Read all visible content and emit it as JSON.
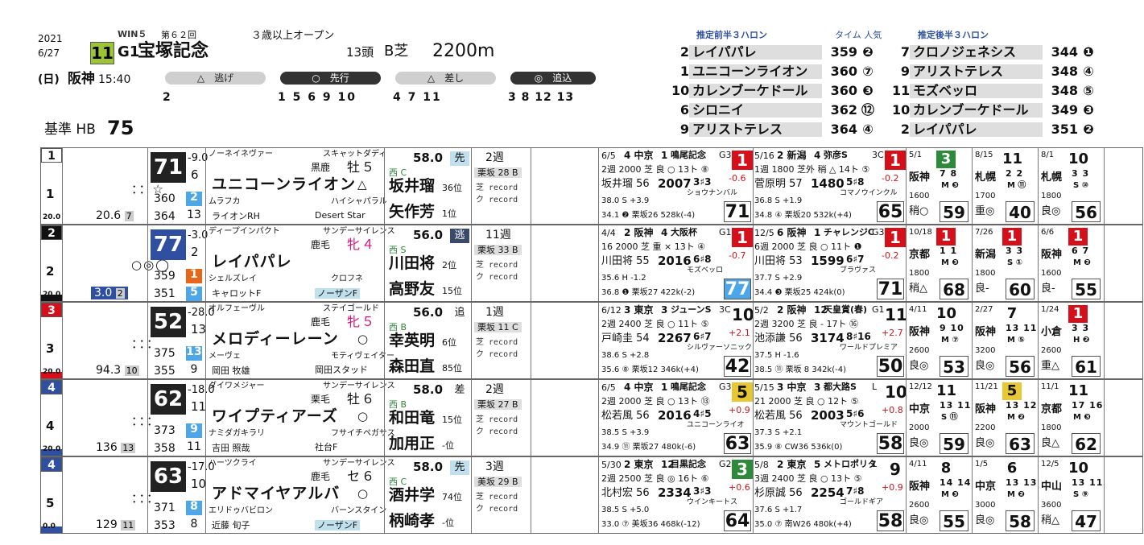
{
  "header": {
    "year": "2021",
    "date": "6/27",
    "win5": "WIN５",
    "kai": "第６２回",
    "race_no": "11",
    "grade": "G1",
    "race_name": "宝塚記念",
    "condition": "３歳以上オープン",
    "heads": "13頭",
    "course": "B芝",
    "distance": "2200m",
    "weekday": "(日)",
    "venue": "阪神",
    "post_time": "15:40",
    "base_label": "基準 HB",
    "base_value": "75",
    "run_styles": [
      {
        "label": "△　逃げ",
        "horses": "2"
      },
      {
        "label": "○　先行",
        "horses": "1 5 6 9 10"
      },
      {
        "label": "△　差し",
        "horses": "4 7 11"
      },
      {
        "label": "◎　追込",
        "horses": "3 8 12 13"
      }
    ]
  },
  "pace": {
    "front_title": "推定前半３ハロン",
    "time_label": "タイム 人気",
    "back_title": "推定後半３ハロン",
    "front": [
      {
        "no": "2",
        "name": "レイパパレ",
        "time": "359",
        "pop": "❷"
      },
      {
        "no": "1",
        "name": "ユニコーンライオン",
        "time": "360",
        "pop": "⑦"
      },
      {
        "no": "10",
        "name": "カレンブーケドール",
        "time": "360",
        "pop": "❸"
      },
      {
        "no": "6",
        "name": "シロニイ",
        "time": "362",
        "pop": "⑫"
      },
      {
        "no": "9",
        "name": "アリストテレス",
        "time": "364",
        "pop": "④"
      }
    ],
    "back": [
      {
        "no": "7",
        "name": "クロノジェネシス",
        "time": "344",
        "pop": "❶"
      },
      {
        "no": "9",
        "name": "アリストテレス",
        "time": "348",
        "pop": "④"
      },
      {
        "no": "11",
        "name": "モズベッロ",
        "time": "348",
        "pop": "⑤"
      },
      {
        "no": "10",
        "name": "カレンブーケドール",
        "time": "349",
        "pop": "❸"
      },
      {
        "no": "2",
        "name": "レイパパレ",
        "time": "351",
        "pop": "❷"
      }
    ]
  },
  "horses": [
    {
      "waku": "1",
      "umaban": "1",
      "marks": "：：☆",
      "odds": "20.6",
      "pop": "7",
      "tansho": "20.0",
      "grade": "71",
      "gdiff": "-9.0",
      "g2": "6",
      "g3": "360",
      "g3b": "2",
      "g4": "364",
      "g4b": "13",
      "sire": "ノーネイネヴァー",
      "dam_sire_top": "スキャットダディ",
      "color": "黒鹿",
      "sex": "牡",
      "age": "５",
      "name": "ユニコーンライオン",
      "mark": "△",
      "dam": "ムラフカ",
      "damsire": "ハイシャパラル",
      "owner": "ライオンRH",
      "breeder": "Desert Star",
      "weight": "58.0",
      "style": "先",
      "stable": "西 C",
      "jockey": "坂井瑠",
      "jrank": "36位",
      "trainer": "矢作芳",
      "trank": "1位",
      "rot": "2週",
      "work": "栗坂 28 B",
      "recent": [
        {
          "date": "6/5",
          "place": "4 中京",
          "no": "1",
          "race": "鳴尾記念",
          "grade": "G3",
          "fin": "1",
          "fc": "r",
          "l2": "2週 2000 芝 良 ○ 13ト ⑧",
          "diff": "-0.6",
          "jk": "坂井瑠 56",
          "time": "2007",
          "c": "3♯3",
          "winner": "ショウナンバル",
          "l4": "38.0 S +3.9",
          "l5": "34.1 ❷ 栗坂26 528k(-4)",
          "spd": "71",
          "spdc": ""
        },
        {
          "date": "5/16",
          "place": "2 新潟",
          "no": "4",
          "race": "弥彦S",
          "grade": "3C",
          "fin": "1",
          "fc": "r",
          "l2": "1週 1800 芝外 稍 △ 14ト ⑤",
          "diff": "-0.2",
          "jk": "菅原明 57",
          "time": "1480",
          "c": "5♯8",
          "winner": "コマノウインクル",
          "l4": "36.8 S +1.9",
          "l5": "34.8 ④ 栗坂20 532k(+4)",
          "spd": "65",
          "spdc": ""
        }
      ],
      "old": [
        {
          "d": "5/1",
          "f": "3",
          "c": "g",
          "v": "阪神",
          "p": "7 8",
          "m": "M ❸",
          "dist": "1600",
          "g": "稍○",
          "s": "59"
        },
        {
          "d": "8/15",
          "f": "11",
          "c": "",
          "v": "札幌",
          "p": "2 2",
          "m": "M ⑪",
          "dist": "1700",
          "g": "重◎",
          "s": "40"
        },
        {
          "d": "8/1",
          "f": "10",
          "c": "",
          "v": "札幌",
          "p": "3 3",
          "m": "S ⑩",
          "dist": "1800",
          "g": "良◎",
          "s": "56"
        }
      ]
    },
    {
      "waku": "2",
      "umaban": "2",
      "marks": "○◎◯",
      "odds": "3.0",
      "pop": "2",
      "tansho": "20.0",
      "grade": "77",
      "gdiff": "-3.0",
      "g2": "2",
      "g3": "359",
      "g3b": "1",
      "g4": "351",
      "g4b": "5",
      "sire": "ディープインパクト",
      "dam_sire_top": "サンデーサイレンス",
      "color": "鹿毛",
      "sex": "牝",
      "age": "４",
      "name": "レイパパレ",
      "mark": "",
      "dam": "シェルズレイ",
      "damsire": "クロフネ",
      "owner": "キャロットF",
      "breeder": "ノーザンF",
      "weight": "56.0",
      "style": "逃",
      "stable": "西 S",
      "jockey": "川田将",
      "jrank": "2位",
      "trainer": "高野友",
      "trank": "15位",
      "rot": "11週",
      "work": "栗坂 33 B",
      "recent": [
        {
          "date": "4/4",
          "place": "2 阪神",
          "no": "4",
          "race": "大阪杯",
          "grade": "G1",
          "fin": "1",
          "fc": "r",
          "l2": "16 2000 芝 重 × 13ト ④",
          "diff": "-0.7",
          "jk": "川田将 55",
          "time": "2016",
          "c": "6♯8",
          "winner": "モズベッロ",
          "l4": "35.6 H -1.2",
          "l5": "36.8 ❶ 栗坂27 422k(-2)",
          "spd": "77",
          "spdc": "bl"
        },
        {
          "date": "12/5",
          "place": "6 阪神",
          "no": "1",
          "race": "チャレンジC",
          "grade": "G3",
          "fin": "1",
          "fc": "r",
          "l2": "6週 2000 芝 良 ○ 11ト ❶",
          "diff": "-0.2",
          "jk": "川田将 53",
          "time": "1599",
          "c": "6♯7",
          "winner": "ブラヴァス",
          "l4": "37.7 S +2.9",
          "l5": "34.4 ❸ 栗坂25 424k(0)",
          "spd": "71",
          "spdc": ""
        }
      ],
      "old": [
        {
          "d": "10/18",
          "f": "1",
          "c": "r",
          "v": "京都",
          "p": "1 1",
          "m": "M ❸",
          "dist": "1800",
          "g": "稍△",
          "s": "68"
        },
        {
          "d": "7/26",
          "f": "1",
          "c": "r",
          "v": "新潟",
          "p": "3 3",
          "m": "S ①",
          "dist": "1800",
          "g": "良-",
          "s": "60"
        },
        {
          "d": "6/6",
          "f": "1",
          "c": "r",
          "v": "阪神",
          "p": "6 7",
          "m": "M ❷",
          "dist": "1600",
          "g": "良-",
          "s": "55"
        }
      ]
    },
    {
      "waku": "3",
      "umaban": "3",
      "marks": "：：：",
      "odds": "94.3",
      "pop": "10",
      "tansho": "20.0",
      "grade": "52",
      "gdiff": "-28.0",
      "g2": "13",
      "g3": "375",
      "g3b": "13",
      "g4": "355",
      "g4b": "9",
      "sire": "オルフェーヴル",
      "dam_sire_top": "ステイゴールド",
      "color": "鹿毛",
      "sex": "牝",
      "age": "５",
      "name": "メロディーレーン",
      "mark": "○",
      "dam": "メーヴェ",
      "damsire": "モティヴェイター",
      "owner": "岡田 牧雄",
      "breeder": "岡田スタッド",
      "weight": "56.0",
      "style": "追",
      "stable": "西 B",
      "jockey": "幸英明",
      "jrank": "6位",
      "trainer": "森田直",
      "trank": "85位",
      "rot": "1週",
      "work": "栗坂 11 C",
      "recent": [
        {
          "date": "6/12",
          "place": "3 東京",
          "no": "3",
          "race": "ジューンS",
          "grade": "3C",
          "fin": "10",
          "fc": "",
          "l2": "2週 2400 芝 良 ○ 11ト ⑤",
          "diff": "+2.1",
          "jk": "戸崎圭 54",
          "time": "2267",
          "c": "6♯7",
          "winner": "シルヴァーソニック",
          "l4": "38.6 S +2.8",
          "l5": "35.6 ⑧ 栗坂12 346k(+4)",
          "spd": "42",
          "spdc": ""
        },
        {
          "date": "5/2",
          "place": "2 阪神",
          "no": "12",
          "race": "天皇賞(春)",
          "grade": "G1",
          "fin": "11",
          "fc": "",
          "l2": "2週 3200 芝 良 - 17ト ⑯",
          "diff": "+2.7",
          "jk": "池添謙 56",
          "time": "3174",
          "c": "8♯16",
          "winner": "ワールドプレミア",
          "l4": "37.5 H -1.6",
          "l5": "38.5 ⑪ 栗坂 8 342k(-4)",
          "spd": "50",
          "spdc": ""
        }
      ],
      "old": [
        {
          "d": "4/11",
          "f": "10",
          "c": "",
          "v": "阪神",
          "p": "9 10",
          "m": "M ⑦",
          "dist": "2600",
          "g": "良◎",
          "s": "53"
        },
        {
          "d": "2/27",
          "f": "7",
          "c": "",
          "v": "阪神",
          "p": "13 11",
          "m": "M ⑤",
          "dist": "3200",
          "g": "良◎",
          "s": "56"
        },
        {
          "d": "1/24",
          "f": "1",
          "c": "r",
          "v": "小倉",
          "p": "3 3",
          "m": "H ❷",
          "dist": "2600",
          "g": "重△",
          "s": "61"
        }
      ]
    },
    {
      "waku": "4",
      "umaban": "4",
      "marks": "：：：",
      "odds": "136",
      "pop": "13",
      "tansho": "20.0",
      "grade": "62",
      "gdiff": "-18.0",
      "g2": "11",
      "g3": "373",
      "g3b": "9",
      "g4": "358",
      "g4b": "11",
      "sire": "ダイワメジャー",
      "dam_sire_top": "サンデーサイレンス",
      "color": "栗毛",
      "sex": "牡",
      "age": "６",
      "name": "ワイプティアーズ",
      "mark": "○",
      "dam": "ナミダガキラリ",
      "damsire": "フサイチペガサス",
      "owner": "吉田 照哉",
      "breeder": "社台F",
      "weight": "58.0",
      "style": "差",
      "stable": "西 B",
      "jockey": "和田竜",
      "jrank": "15位",
      "trainer": "加用正",
      "trank": "-位",
      "rot": "2週",
      "work": "栗坂 27 B",
      "recent": [
        {
          "date": "6/5",
          "place": "4 中京",
          "no": "1",
          "race": "鳴尾記念",
          "grade": "G3",
          "fin": "5",
          "fc": "y",
          "l2": "2週 2000 芝 良 ○ 13ト ⑬",
          "diff": "+0.9",
          "jk": "松若風 56",
          "time": "2016",
          "c": "4♯5",
          "winner": "ユニコーンライオ",
          "l4": "38.5 S +3.9",
          "l5": "34.9 ⑪ 栗坂27 480k(-6)",
          "spd": "63",
          "spdc": ""
        },
        {
          "date": "5/15",
          "place": "3 中京",
          "no": "3",
          "race": "都大路S",
          "grade": "L",
          "fin": "10",
          "fc": "",
          "l2": "21 2000 芝 良 ○ 12ト ⑤",
          "diff": "+0.8",
          "jk": "松若風 56",
          "time": "2003",
          "c": "5♯6",
          "winner": "マウントゴールド",
          "l4": "37.3 S +2.1",
          "l5": "35.9 ⑧ CW36 536k(0)",
          "spd": "58",
          "spdc": ""
        }
      ],
      "old": [
        {
          "d": "12/12",
          "f": "11",
          "c": "",
          "v": "中京",
          "p": "13 11",
          "m": "S ⑪",
          "dist": "2000",
          "g": "良◎",
          "s": "59"
        },
        {
          "d": "11/21",
          "f": "5",
          "c": "y",
          "v": "阪神",
          "p": "13 12",
          "m": "M ❷",
          "dist": "2200",
          "g": "良◎",
          "s": "63"
        },
        {
          "d": "11/1",
          "f": "11",
          "c": "",
          "v": "京都",
          "p": "17 16",
          "m": "M ❸",
          "dist": "1800",
          "g": "良△",
          "s": "62"
        }
      ]
    },
    {
      "waku": "4",
      "umaban": "5",
      "marks": "：：：",
      "odds": "129",
      "pop": "11",
      "tansho": "0.0",
      "grade": "63",
      "gdiff": "-17.0",
      "g2": "10",
      "g3": "371",
      "g3b": "8",
      "g4": "353",
      "g4b": "8",
      "sire": "ハーツクライ",
      "dam_sire_top": "サンデーサイレンス",
      "color": "鹿毛",
      "sex": "セ",
      "age": "６",
      "name": "アドマイヤアルバ",
      "mark": "○",
      "dam": "エリドゥバビロン",
      "damsire": "バーンスタイン",
      "owner": "近藤 旬子",
      "breeder": "ノーザンF",
      "weight": "58.0",
      "style": "先",
      "stable": "西 C",
      "jockey": "酒井学",
      "jrank": "74位",
      "trainer": "柄崎孝",
      "trank": "-位",
      "rot": "3週",
      "work": "美坂 29 B",
      "recent": [
        {
          "date": "5/30",
          "place": "2 東京",
          "no": "12",
          "race": "目黒記念",
          "grade": "G2",
          "fin": "3",
          "fc": "g",
          "l2": "2週 2500 芝 良 ◎ 16ト ⑥",
          "diff": "+0.6",
          "jk": "北村宏 56",
          "time": "2334",
          "c": "3♯3",
          "winner": "ウインキートス",
          "l4": "38.5 S +5.0",
          "l5": "33.0 ⑦ 美坂36 468k(-12)",
          "spd": "64",
          "spdc": ""
        },
        {
          "date": "5/8",
          "place": "2 東京",
          "no": "5",
          "race": "メトロポリタ",
          "grade": "L",
          "fin": "9",
          "fc": "",
          "l2": "3週 2400 芝 良 ○ 13ト ⑤",
          "diff": "+0.9",
          "jk": "杉原誠 56",
          "time": "2254",
          "c": "7♯8",
          "winner": "ゴールドギア",
          "l4": "37.6 S +1.7",
          "l5": "35.0 ⑦ 南W26 480k(+4)",
          "spd": "58",
          "spdc": ""
        }
      ],
      "old": [
        {
          "d": "4/11",
          "f": "8",
          "c": "",
          "v": "阪神",
          "p": "14 14",
          "m": "M ❸",
          "dist": "2600",
          "g": "良◎",
          "s": "55"
        },
        {
          "d": "1/5",
          "f": "6",
          "c": "",
          "v": "中京",
          "p": "13 13",
          "m": "M ❷",
          "dist": "3000",
          "g": "良◎",
          "s": "58"
        },
        {
          "d": "12/5",
          "f": "10",
          "c": "",
          "v": "中山",
          "p": "13 11",
          "m": "S ⑨",
          "dist": "3600",
          "g": "稍△",
          "s": "47"
        }
      ]
    }
  ]
}
